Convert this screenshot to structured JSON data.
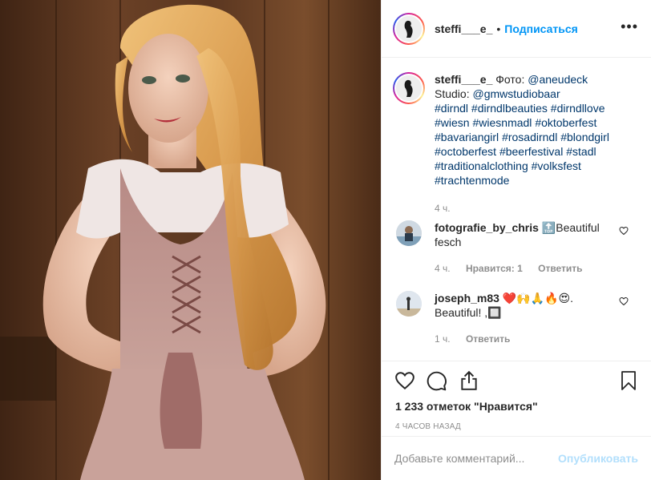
{
  "post": {
    "username": "steffi___e_",
    "separator": "•",
    "follow_label": "Подписаться",
    "more_label": "•••"
  },
  "caption": {
    "username": "steffi___e_",
    "text_prefix": " Фото: ",
    "mention1": "@aneudeck",
    "studio_label": "Studio: ",
    "mention2": "@gmwstudiobaar",
    "hashtags": [
      "#dirndl",
      "#dirndlbeauties",
      "#dirndllove",
      "#wiesn",
      "#wiesnmadl",
      "#oktoberfest",
      "#bavariangirl",
      "#rosadirndl",
      "#blondgirl",
      "#octoberfest",
      "#beerfestival",
      "#stadl",
      "#traditionalclothing",
      "#volksfest",
      "#trachtenmode"
    ],
    "time": "4 ч."
  },
  "comments": [
    {
      "username": "fotografie_by_chris",
      "text": "🔝Beautiful fesch",
      "time": "4 ч.",
      "likes_label": "Нравится: 1",
      "reply_label": "Ответить"
    },
    {
      "username": "joseph_m83",
      "text": "❤️🙌🙏🔥😍. Beautiful! ,🔲",
      "time": "1 ч.",
      "reply_label": "Ответить"
    }
  ],
  "actions": {
    "likes": "1 233 отметок \"Нравится\"",
    "timestamp": "4 ЧАСОВ НАЗАД"
  },
  "add_comment": {
    "placeholder": "Добавьте комментарий...",
    "publish_label": "Опубликовать"
  },
  "icons": {
    "like": "heart-icon",
    "comment": "comment-icon",
    "share": "share-icon",
    "save": "bookmark-icon",
    "comment_like": "heart-icon"
  },
  "colors": {
    "link_blue": "#0095f6",
    "hashtag": "#00376b",
    "muted": "#8e8e8e",
    "publish_disabled": "#b2dffc"
  }
}
